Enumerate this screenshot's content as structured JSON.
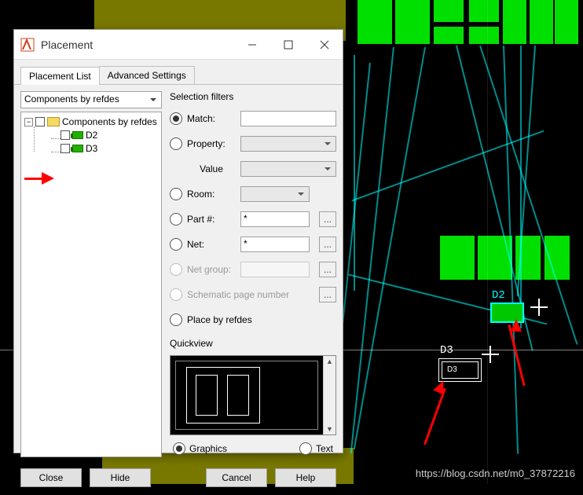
{
  "window": {
    "title": "Placement"
  },
  "tabs": {
    "list": "Placement List",
    "adv": "Advanced Settings"
  },
  "combo_value": "Components by refdes",
  "tree": {
    "root": "Components by refdes",
    "items": [
      {
        "label": "D2"
      },
      {
        "label": "D3"
      }
    ]
  },
  "filters": {
    "heading": "Selection filters",
    "match": "Match:",
    "property": "Property:",
    "value": "Value",
    "room": "Room:",
    "partno": "Part #:",
    "net": "Net:",
    "netgroup": "Net group:",
    "schpage": "Schematic page number",
    "placebyref": "Place by refdes",
    "partno_value": "*",
    "net_value": "*"
  },
  "quickview": {
    "heading": "Quickview",
    "graphics": "Graphics",
    "text": "Text"
  },
  "buttons": {
    "close": "Close",
    "hide": "Hide",
    "cancel": "Cancel",
    "help": "Help"
  },
  "dots": "...",
  "pcb_labels": {
    "d2": "D2",
    "d3": "D3",
    "d3inner": "D3"
  },
  "watermark": "https://blog.csdn.net/m0_37872216"
}
